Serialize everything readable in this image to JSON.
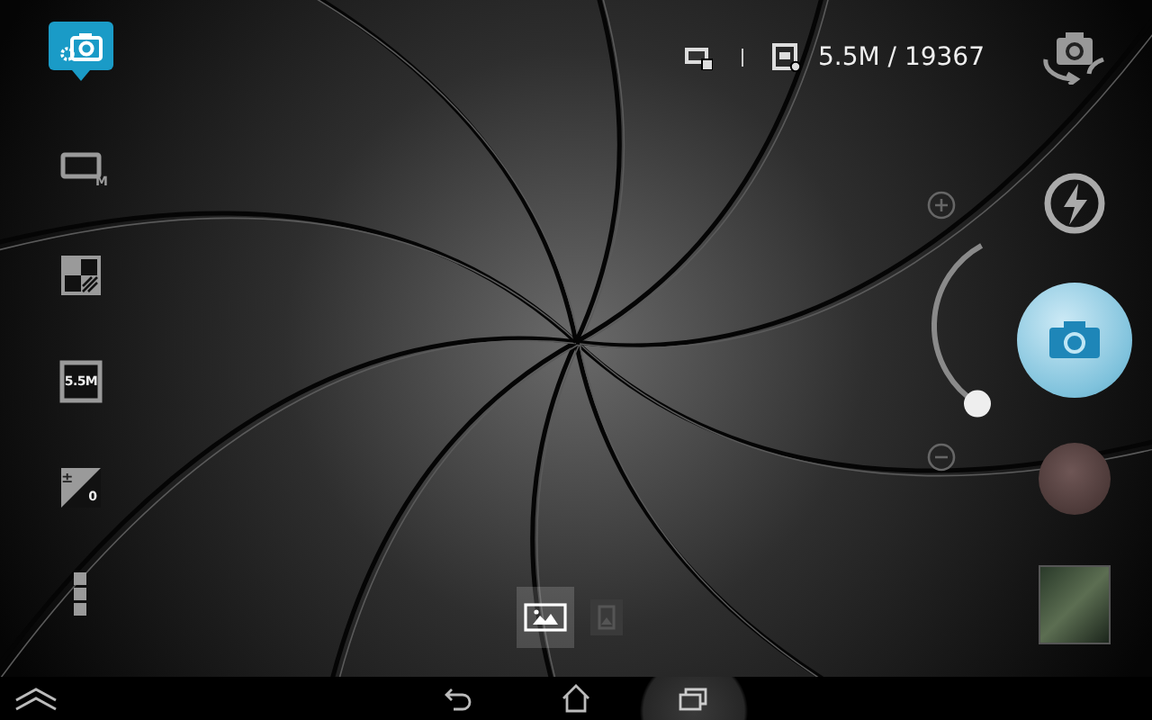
{
  "sidebar": {
    "items": [
      {
        "kind": "settings",
        "selected": true
      },
      {
        "kind": "mode",
        "label": "M",
        "selected": false
      },
      {
        "kind": "effect",
        "selected": false
      },
      {
        "kind": "resolution",
        "label": "5.5M",
        "selected": false
      },
      {
        "kind": "exposure",
        "top_label": "±",
        "label": "0",
        "selected": false
      },
      {
        "kind": "more",
        "selected": false
      }
    ]
  },
  "status": {
    "picture_count": "5.5M / 19367"
  },
  "zoom": {
    "level": 0
  },
  "capture_modes": [
    {
      "kind": "photo",
      "selected": true
    },
    {
      "kind": "panorama",
      "selected": false
    }
  ]
}
